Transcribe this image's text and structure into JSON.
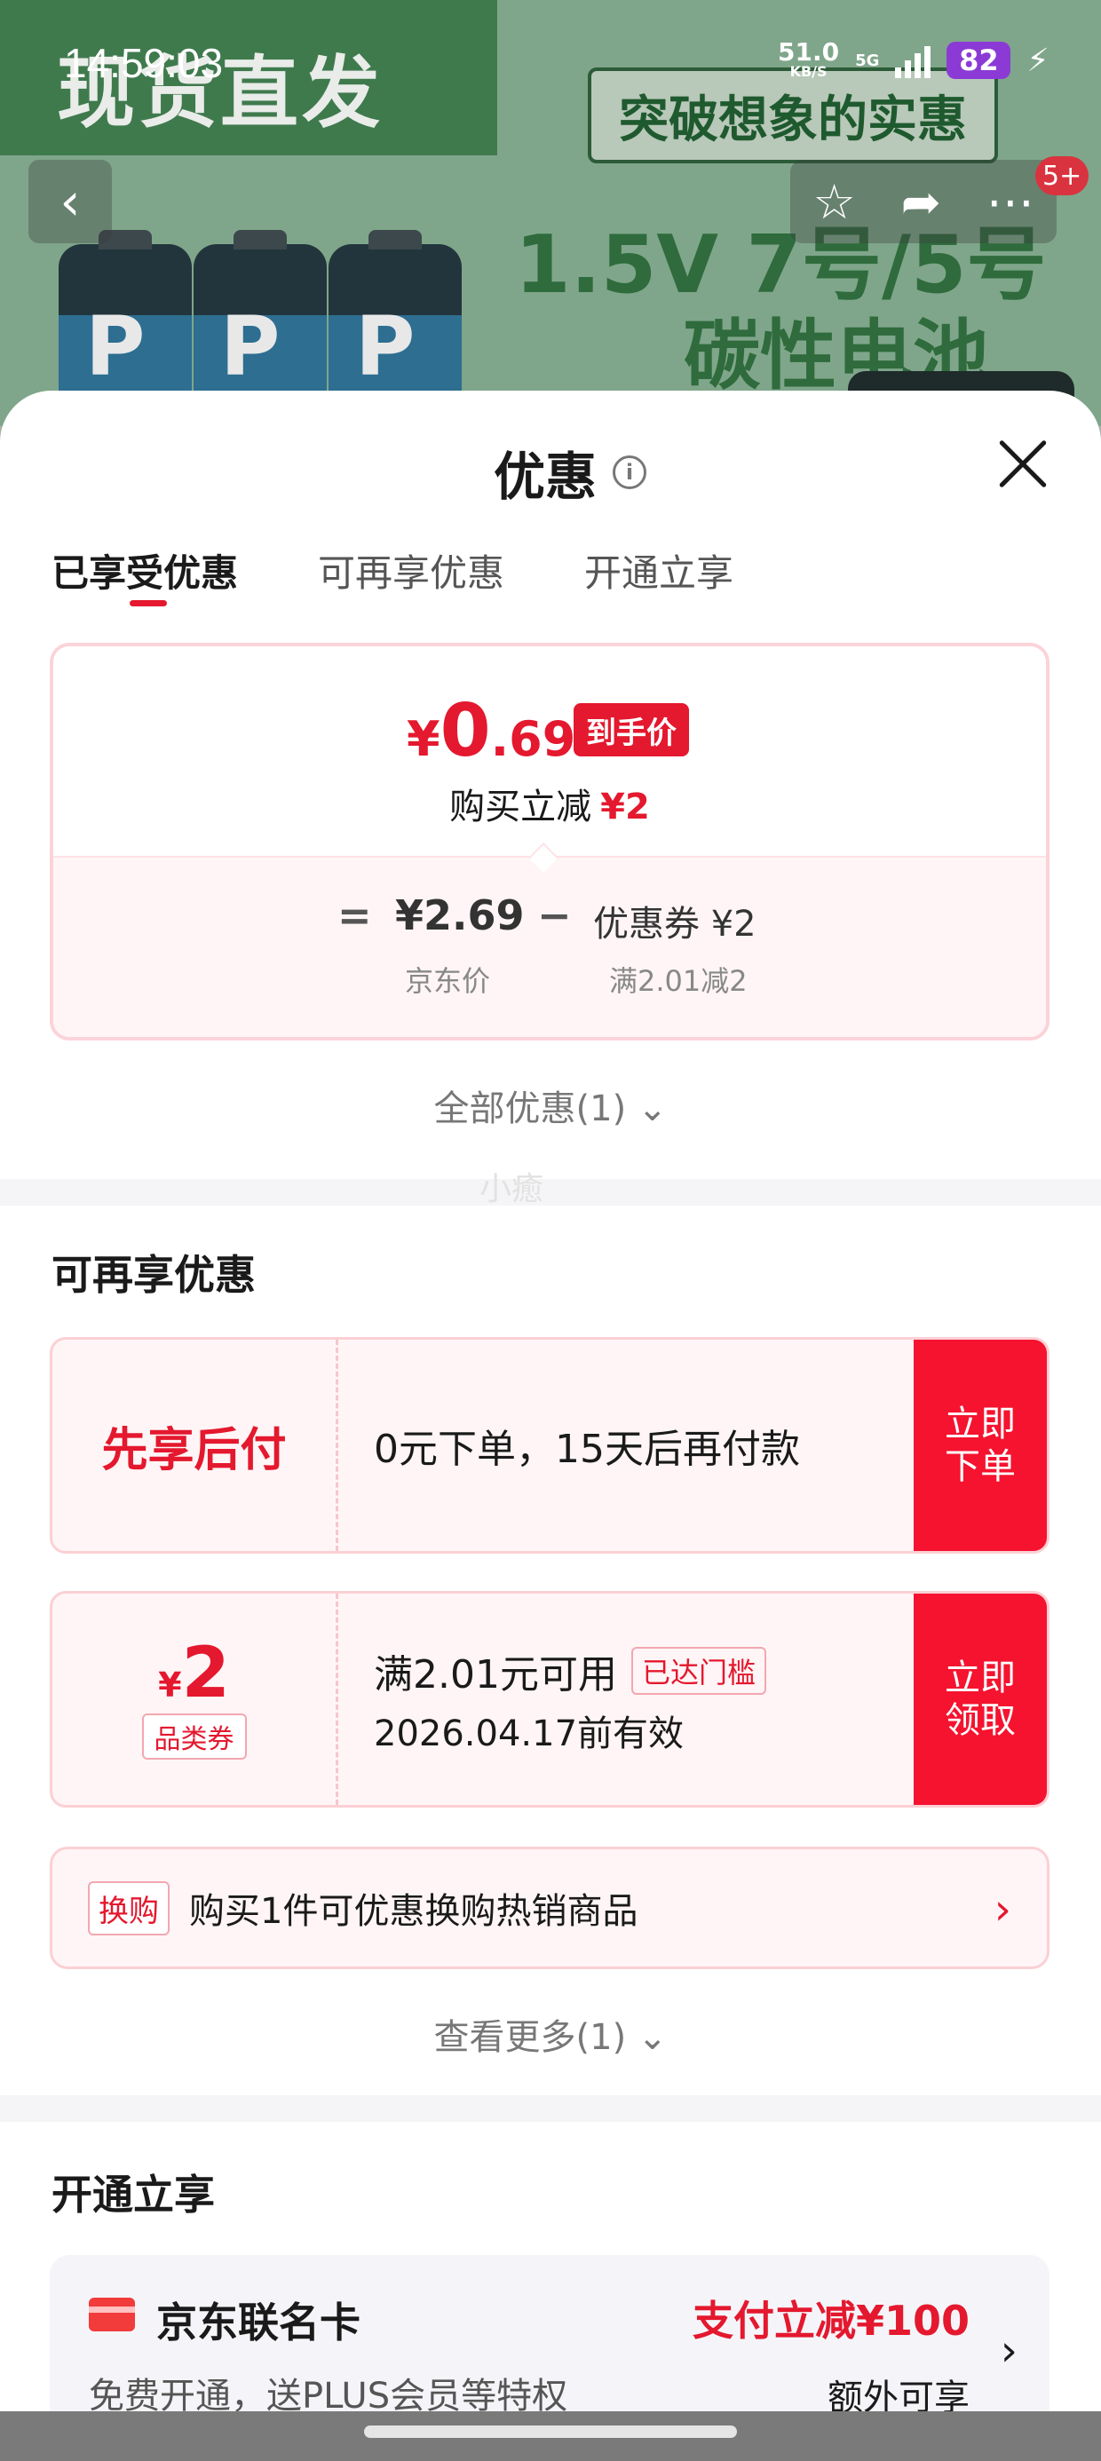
{
  "status_bar": {
    "time": "14:59:03",
    "net_speed": "51.0",
    "net_unit": "KB/S",
    "signal": "5G",
    "battery": "82"
  },
  "banner": {
    "slogan": "现货直发",
    "highlight": "突破想象的实惠",
    "spec_line1": "1.5V 7号/5号",
    "spec_line2": "碳性电池",
    "battery_letter": "P",
    "badge": "5+"
  },
  "sheet": {
    "title": "优惠",
    "tabs": [
      {
        "label": "已享受优惠",
        "active": true
      },
      {
        "label": "可再享优惠",
        "active": false
      },
      {
        "label": "开通立享",
        "active": false
      }
    ]
  },
  "price_card": {
    "currency": "¥",
    "final_int": "0",
    "final_dec": ".69",
    "tag": "到手价",
    "instant_cut_label": "购买立减",
    "instant_cut_value": "¥2",
    "formula_eq": "=",
    "jd_price": "¥2.69",
    "formula_minus": "−",
    "coupon_value": "优惠券 ¥2",
    "jd_price_label": "京东价",
    "coupon_rule": "满2.01减2"
  },
  "all_discounts": "全部优惠(1)",
  "watermark": "小癒",
  "more_offers": {
    "title": "可再享优惠",
    "bnpl": {
      "name": "先享后付",
      "text": "0元下单，15天后再付款",
      "button": "立即\n下单"
    },
    "coupon": {
      "currency": "¥",
      "amount": "2",
      "type": "品类券",
      "condition": "满2.01元可用",
      "status": "已达门槛",
      "expiry": "2026.04.17前有效",
      "button": "立即\n领取"
    },
    "trade_in": {
      "tag": "换购",
      "text": "购买1件可优惠换购热销商品"
    },
    "see_more": "查看更多(1)"
  },
  "open_enjoy": {
    "title": "开通立享",
    "card_name": "京东联名卡",
    "card_desc": "免费开通，送PLUS会员等特权",
    "card_promo": "支付立减¥100",
    "card_extra": "额外可享"
  },
  "colors": {
    "accent_red": "#e4182e",
    "button_red": "#f5132f",
    "card_pink_bg": "#fff5f6",
    "banner_green": "#2f6b3c"
  }
}
